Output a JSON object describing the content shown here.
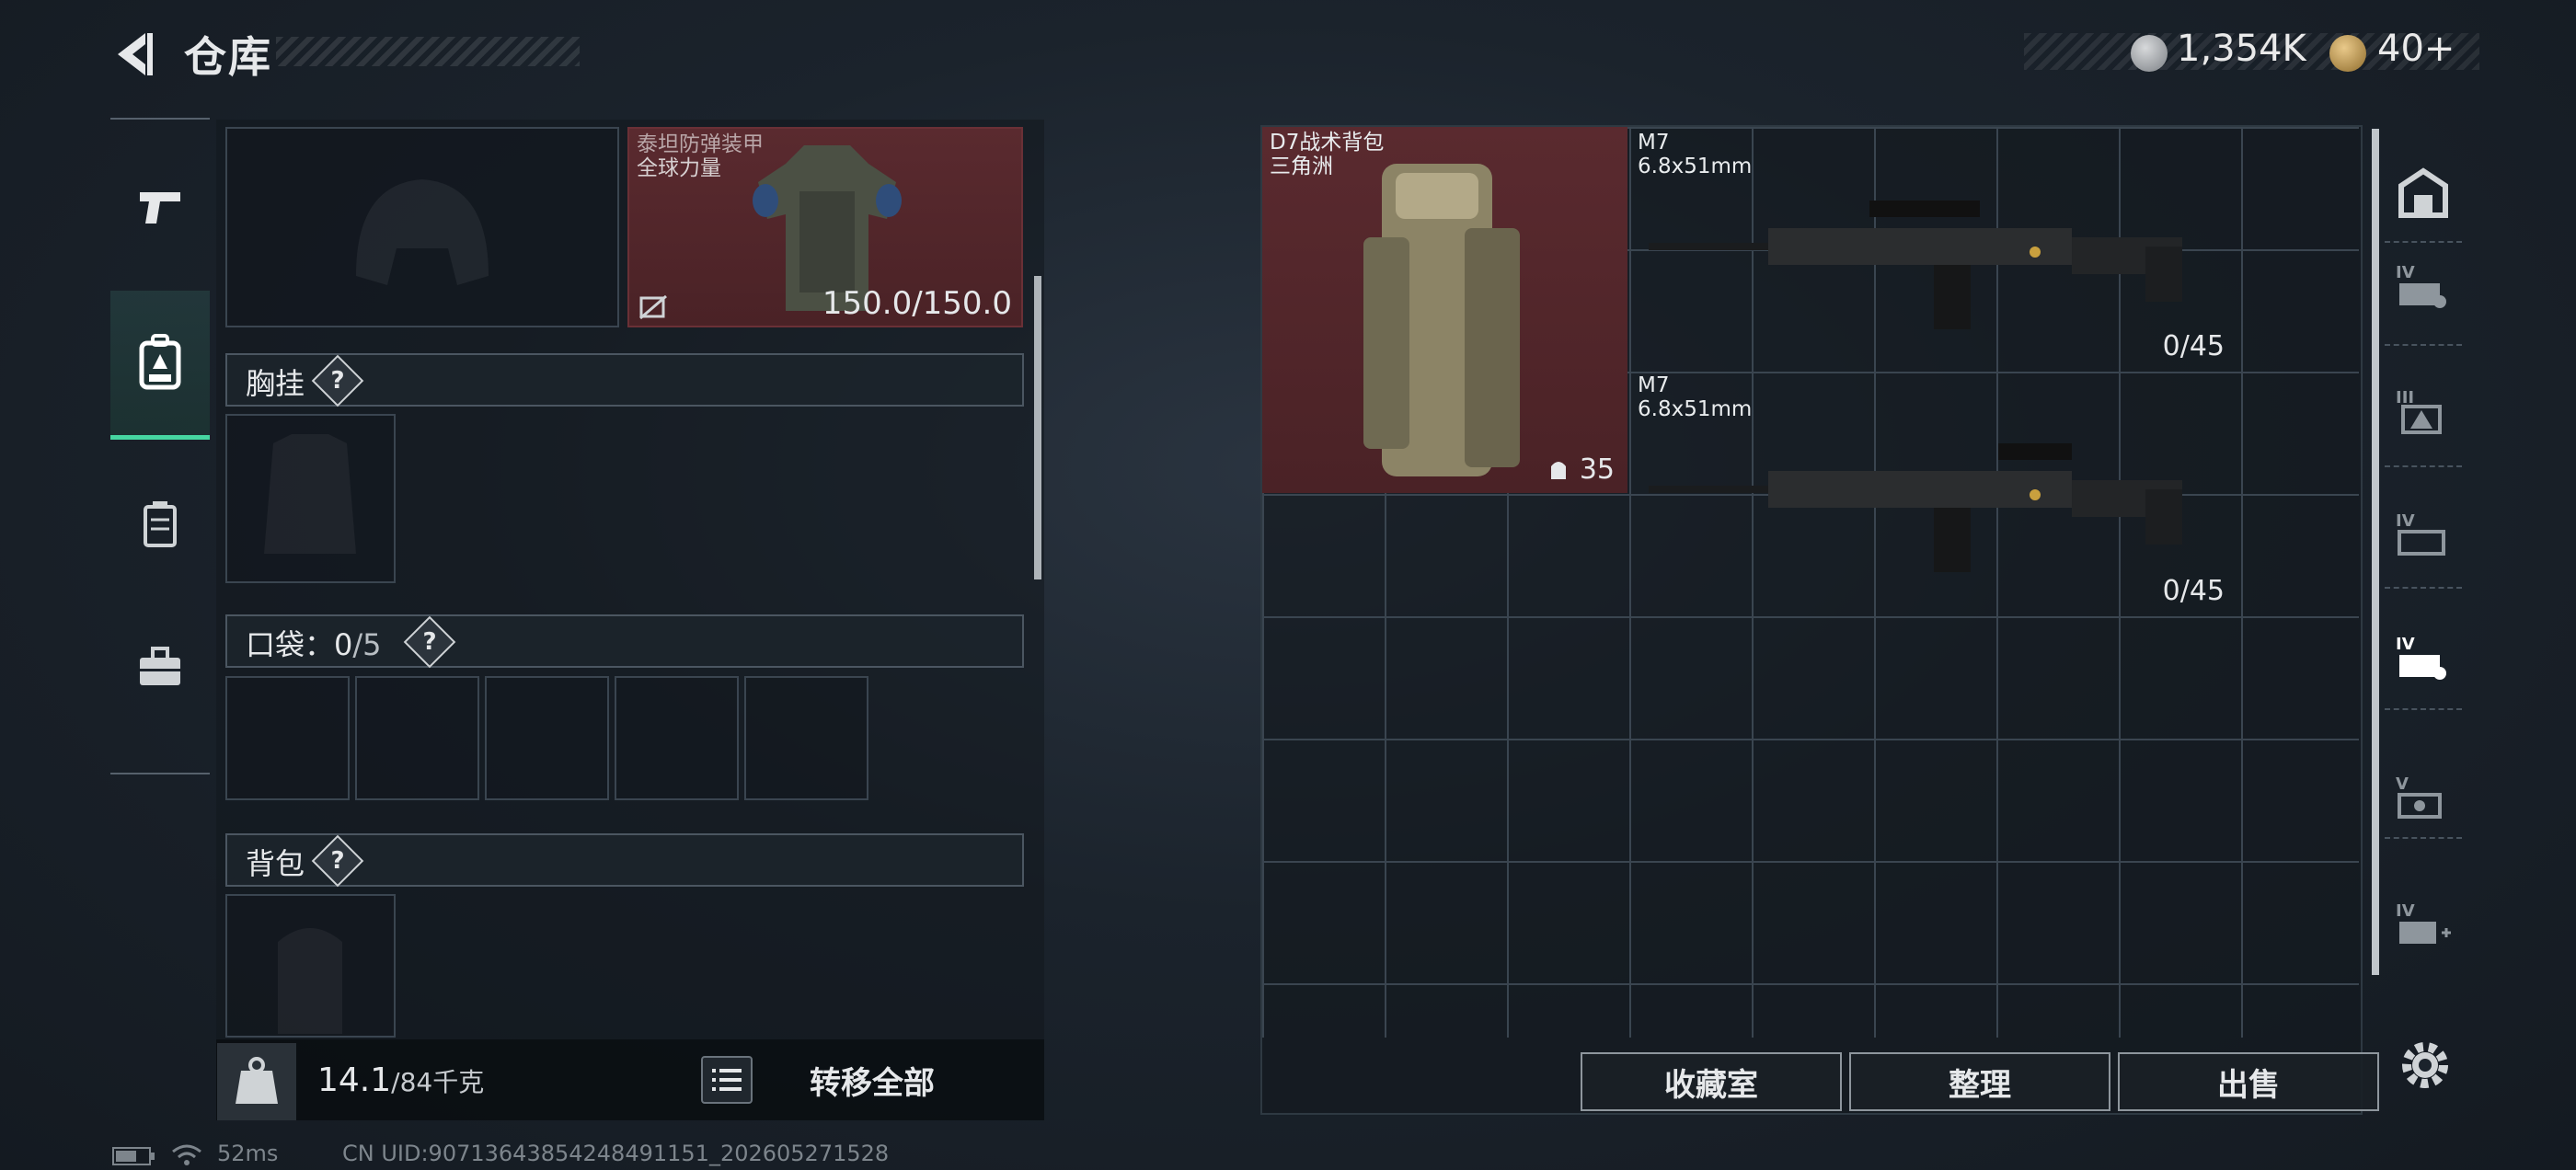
{
  "header": {
    "title": "仓库",
    "currency": {
      "coins": "1,354K",
      "tokens": "40+"
    }
  },
  "left_nav": {
    "items": [
      {
        "name": "weapons",
        "icon": "pistol-icon",
        "active": false
      },
      {
        "name": "gear",
        "icon": "backpack-icon",
        "active": true
      },
      {
        "name": "consumables",
        "icon": "canister-icon",
        "active": false
      },
      {
        "name": "tools",
        "icon": "toolbox-icon",
        "active": false
      }
    ]
  },
  "equipment": {
    "armor": {
      "name": "泰坦防弹装甲",
      "brand": "全球力量",
      "durability": "150.0/150.0"
    },
    "chest_rig": {
      "label": "胸挂",
      "help": "?"
    },
    "pockets": {
      "label": "口袋：",
      "used": "0",
      "capacity": "/5",
      "help": "?"
    },
    "backpack": {
      "label": "背包",
      "help": "?"
    }
  },
  "weight": {
    "current": "14.1",
    "max": "/84千克"
  },
  "actions": {
    "transfer_all": "转移全部"
  },
  "storage": {
    "items": [
      {
        "name": "D7战术背包",
        "sub": "三角洲",
        "count": "35"
      },
      {
        "name": "M7",
        "sub": "6.8x51mm",
        "count": "0/45"
      },
      {
        "name": "M7",
        "sub": "6.8x51mm",
        "count": "0/45"
      }
    ],
    "right_tabs": [
      "home-icon",
      "storage-tab-iv-icon",
      "storage-tab-iii-icon",
      "storage-tab-iv-b-icon",
      "storage-tab-iv-active-icon",
      "storage-tab-v-icon",
      "storage-tab-iv-add-icon"
    ],
    "buttons": {
      "collection": "收藏室",
      "sort": "整理",
      "sell": "出售"
    }
  },
  "status_bar": {
    "ping": "52ms",
    "uid": "CN UID:90713643854248491151_202605271528"
  },
  "colors": {
    "accent": "#46d6a1",
    "rarity_red": "#5a2a2f"
  }
}
